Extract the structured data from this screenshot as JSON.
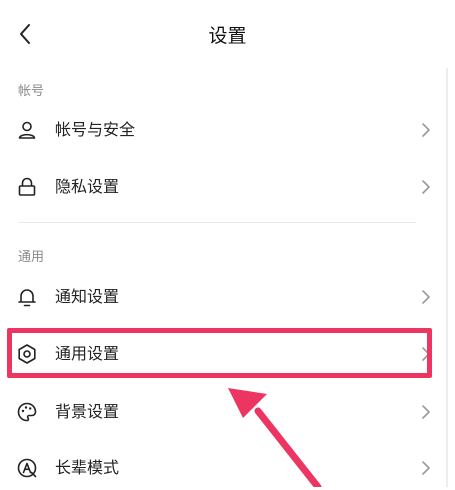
{
  "header": {
    "title": "设置",
    "back_icon": "chevron-left-icon"
  },
  "sections": [
    {
      "label": "帐号"
    },
    {
      "label": "通用"
    }
  ],
  "account_items": [
    {
      "label": "帐号与安全",
      "icon": "user-icon"
    },
    {
      "label": "隐私设置",
      "icon": "lock-icon"
    }
  ],
  "general_items": [
    {
      "label": "通知设置",
      "icon": "bell-icon"
    },
    {
      "label": "通用设置",
      "icon": "gear-icon"
    },
    {
      "label": "背景设置",
      "icon": "palette-icon"
    },
    {
      "label": "长辈模式",
      "icon": "elder-mode-icon"
    }
  ],
  "annotation": {
    "highlight_color": "#ec3560"
  }
}
